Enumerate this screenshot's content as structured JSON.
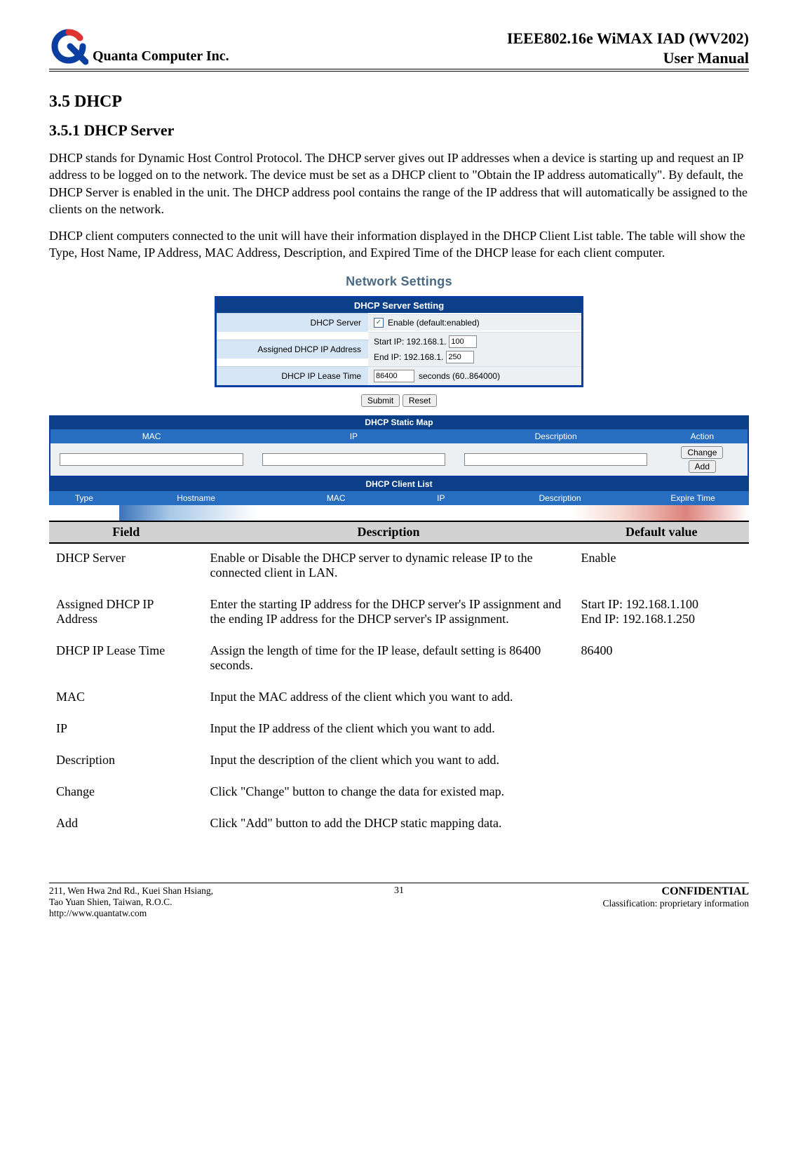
{
  "header": {
    "brand": "Quanta  Computer  Inc.",
    "title_line1": "IEEE802.16e  WiMAX  IAD  (WV202)",
    "title_line2": "User  Manual"
  },
  "sections": {
    "num": "3.5  DHCP",
    "sub": "3.5.1   DHCP Server",
    "p1": "DHCP stands for Dynamic Host Control Protocol. The DHCP server gives out IP addresses when a device is starting up and request an IP address to be logged on to the network. The device must be set as a DHCP client to \"Obtain the IP address automatically\". By default, the DHCP Server is enabled in the unit. The DHCP address pool contains the range of the IP address that will automatically be assigned to the clients on the network.",
    "p2": "DHCP client computers connected to the unit will have their information displayed in the DHCP Client List table. The table will show the Type, Host Name, IP Address, MAC Address, Description, and Expired Time of the DHCP lease for each client computer."
  },
  "screenshot": {
    "title": "Network Settings",
    "panel_head": "DHCP Server Setting",
    "row1_lbl": "DHCP Server",
    "row1_val": "Enable (default:enabled)",
    "row2_lbl": "Assigned DHCP IP Address",
    "row2_start_lbl": "Start IP: 192.168.1.",
    "row2_start_val": "100",
    "row2_end_lbl": "End IP: 192.168.1.",
    "row2_end_val": "250",
    "row3_lbl": "DHCP IP Lease Time",
    "row3_val": "86400",
    "row3_suffix": "seconds (60..864000)",
    "btn_submit": "Submit",
    "btn_reset": "Reset",
    "static_map_head": "DHCP Static Map",
    "sm_mac": "MAC",
    "sm_ip": "IP",
    "sm_desc": "Description",
    "sm_action": "Action",
    "btn_change": "Change",
    "btn_add": "Add",
    "client_list_head": "DHCP Client List",
    "cl_type": "Type",
    "cl_host": "Hostname",
    "cl_mac": "MAC",
    "cl_ip": "IP",
    "cl_desc": "Description",
    "cl_exp": "Expire Time"
  },
  "fields_table": {
    "h_field": "Field",
    "h_desc": "Description",
    "h_def": "Default value",
    "rows": [
      {
        "f": "DHCP Server",
        "d": "Enable or Disable the DHCP server to dynamic release IP to the connected client in LAN.",
        "v": "Enable"
      },
      {
        "f": "Assigned DHCP IP Address",
        "d": "Enter the starting IP address for the DHCP server's IP assignment and the ending IP address for the DHCP server's IP assignment.",
        "v": "Start IP: 192.168.1.100\nEnd IP: 192.168.1.250"
      },
      {
        "f": "DHCP IP Lease Time",
        "d": "Assign the length of time for the IP lease, default setting is 86400 seconds.",
        "v": "86400"
      },
      {
        "f": "MAC",
        "d": "Input the MAC address of the client which you want to add.",
        "v": ""
      },
      {
        "f": "IP",
        "d": "Input the IP address of the client which you want to add.",
        "v": ""
      },
      {
        "f": "Description",
        "d": "Input the description of the client which you want to add.",
        "v": ""
      },
      {
        "f": "Change",
        "d": "Click \"Change\" button to change the data for existed map.",
        "v": ""
      },
      {
        "f": "Add",
        "d": "Click \"Add\" button to add the DHCP static mapping data.",
        "v": ""
      }
    ]
  },
  "footer": {
    "addr1": "211, Wen Hwa 2nd Rd., Kuei Shan Hsiang,",
    "addr2": "Tao Yuan Shien, Taiwan, R.O.C.",
    "addr3": "http://www.quantatw.com",
    "page": "31",
    "conf": "CONFIDENTIAL",
    "class": "Classification: proprietary information"
  }
}
